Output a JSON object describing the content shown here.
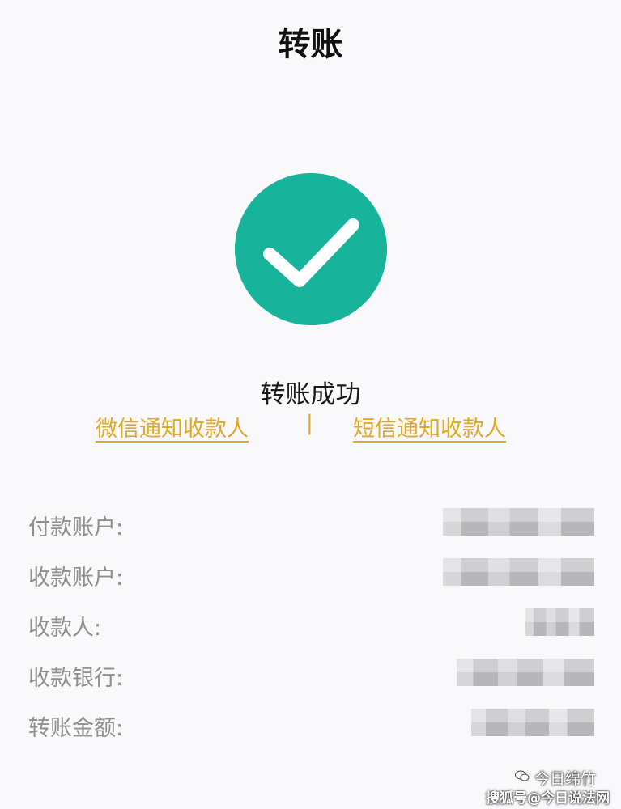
{
  "header": {
    "title": "转账"
  },
  "result": {
    "icon": "check-circle-icon",
    "status": "转账成功",
    "accent_color": "#17b39a"
  },
  "notify": {
    "wechat_label": "微信通知收款人",
    "separator": "|",
    "sms_label": "短信通知收款人",
    "link_color": "#e0a923"
  },
  "details": [
    {
      "label": "付款账户:"
    },
    {
      "label": "收款账户:"
    },
    {
      "label": "收款人:"
    },
    {
      "label": "收款银行:"
    },
    {
      "label": "转账金额:"
    }
  ],
  "watermark": {
    "icon": "wechat-logo-icon",
    "line1": "今日绵竹",
    "line2": "搜狐号@今日说法网"
  }
}
